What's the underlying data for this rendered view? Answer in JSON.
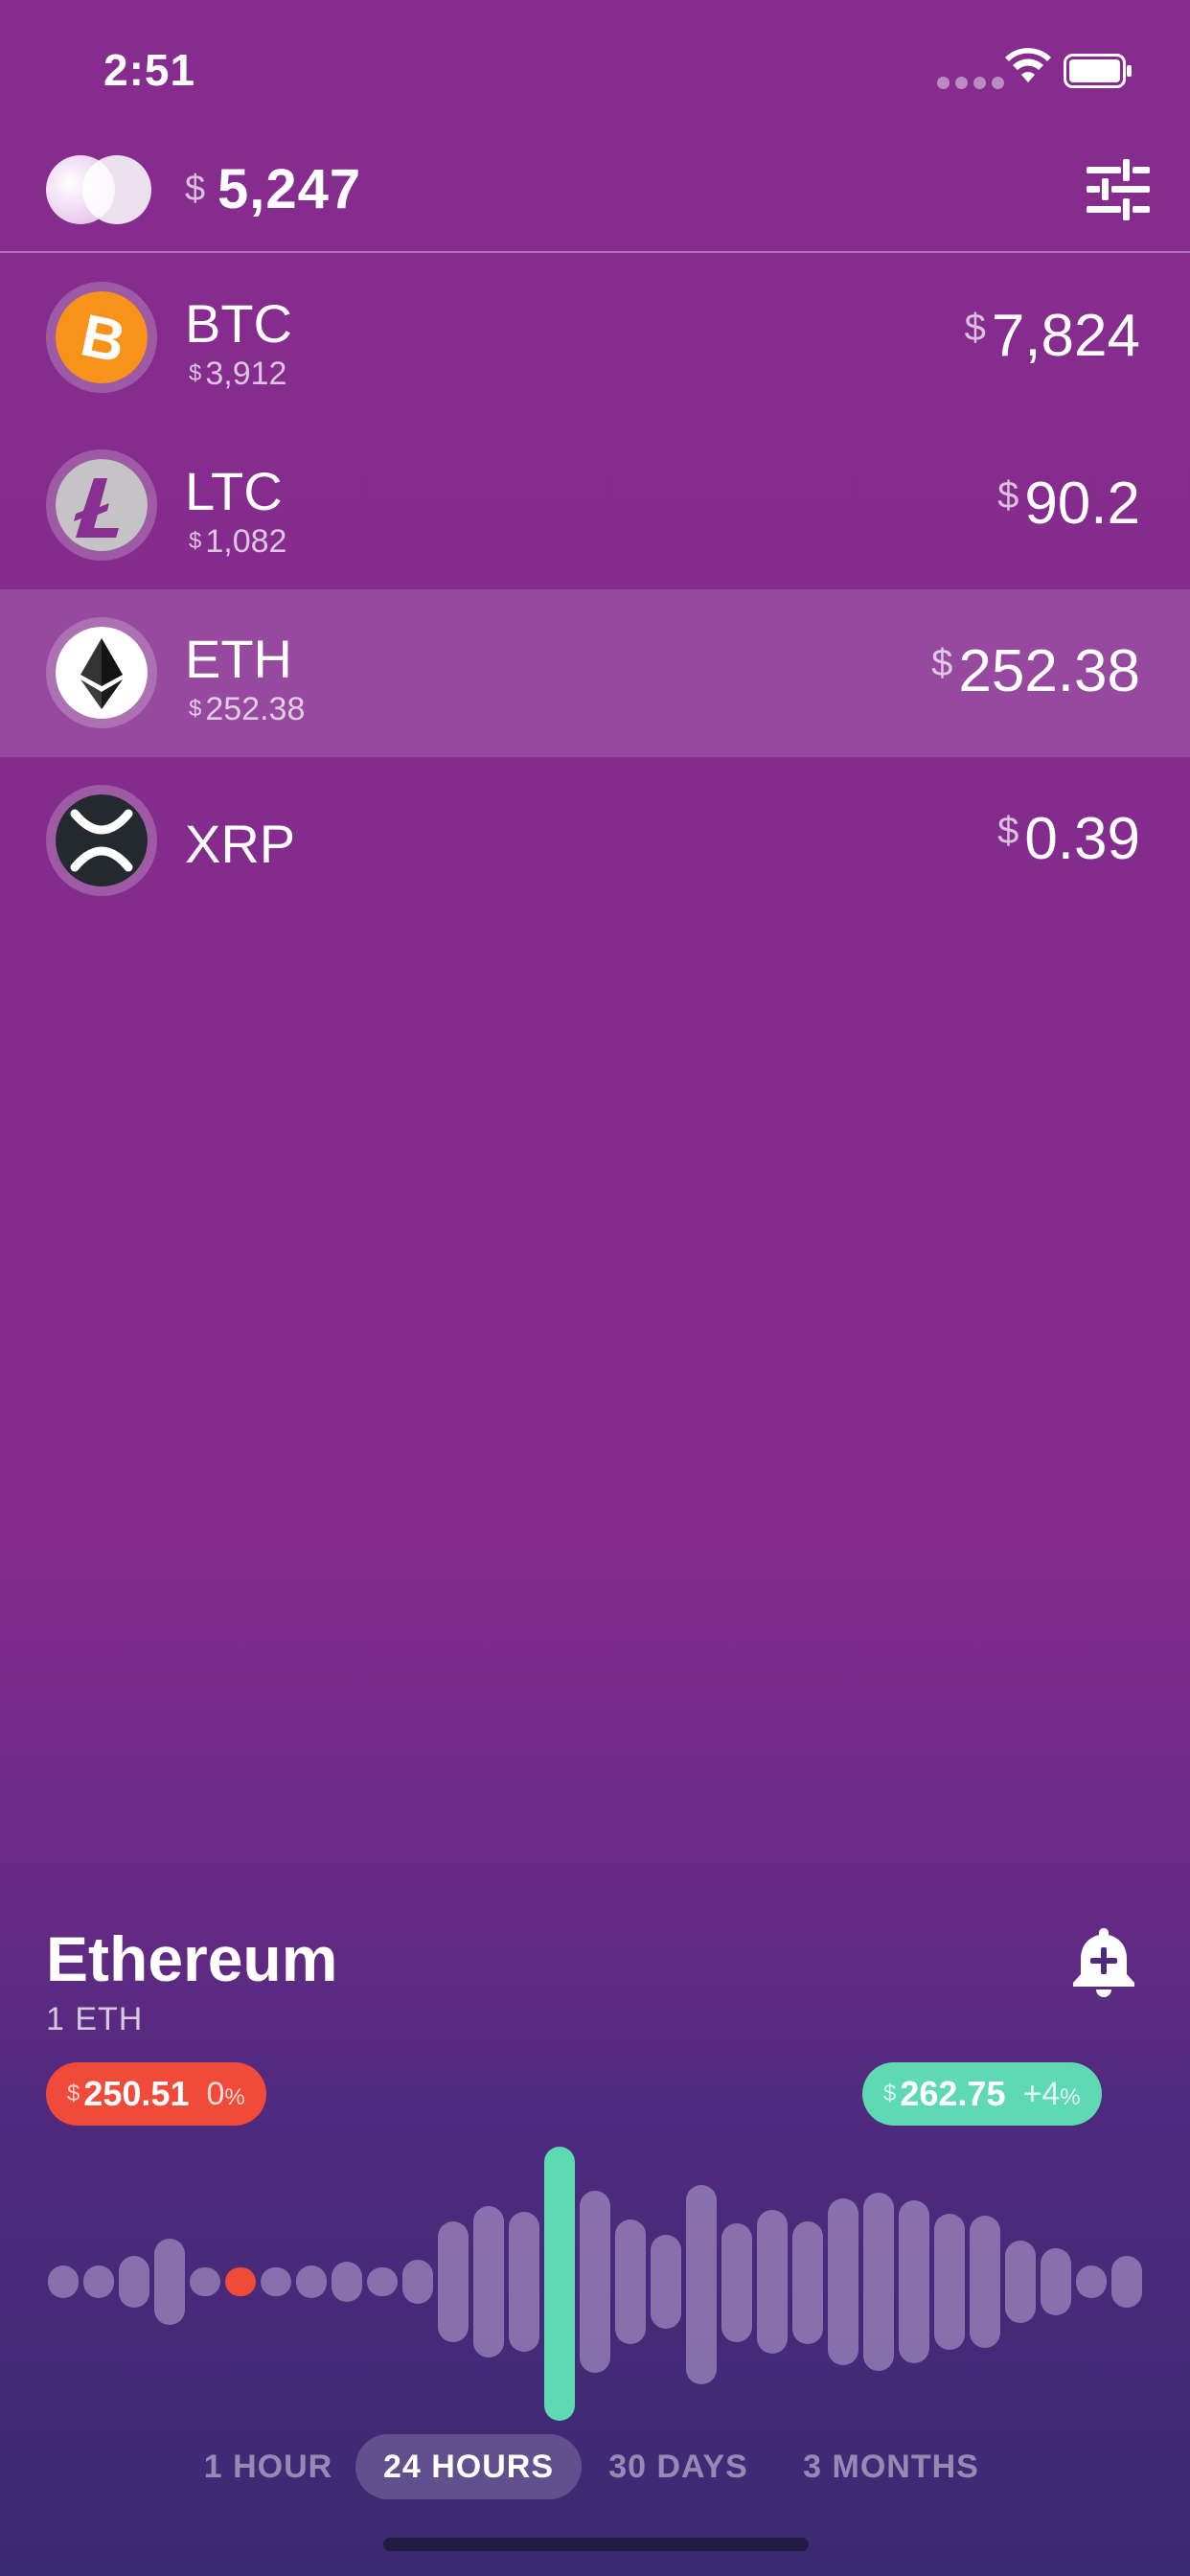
{
  "status": {
    "time": "2:51"
  },
  "header": {
    "currency_symbol": "$",
    "total": "5,247"
  },
  "coins": [
    {
      "symbol": "BTC",
      "sub_symbol": "$",
      "sub_value": "3,912",
      "price_symbol": "$",
      "price": "7,824",
      "icon": "bitcoin-icon",
      "color": "#f7931a"
    },
    {
      "symbol": "LTC",
      "sub_symbol": "$",
      "sub_value": "1,082",
      "price_symbol": "$",
      "price": "90.2",
      "icon": "litecoin-icon",
      "color": "#bfbbbb"
    },
    {
      "symbol": "ETH",
      "sub_symbol": "$",
      "sub_value": "252.38",
      "price_symbol": "$",
      "price": "252.38",
      "icon": "ethereum-icon",
      "color": "#ffffff"
    },
    {
      "symbol": "XRP",
      "price_symbol": "$",
      "price": "0.39",
      "icon": "xrp-icon",
      "color": "#23292f"
    }
  ],
  "detail": {
    "name": "Ethereum",
    "amount": "1 ETH",
    "low": {
      "symbol": "$",
      "value": "250.51",
      "change": "0",
      "unit": "%"
    },
    "high": {
      "symbol": "$",
      "value": "262.75",
      "change": "+4",
      "unit": "%"
    },
    "range_options": [
      "1 HOUR",
      "24 HOURS",
      "30 DAYS",
      "3 MONTHS"
    ],
    "selected_range": "24 HOURS",
    "colors": {
      "low": "#f04a3a",
      "high": "#5fd9b3"
    }
  }
}
